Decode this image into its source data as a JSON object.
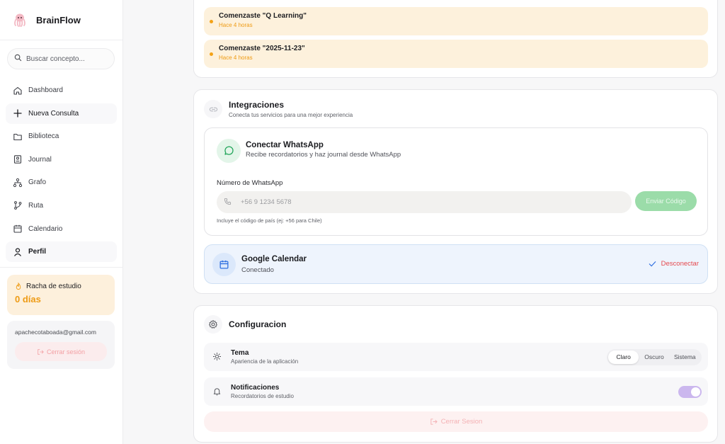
{
  "app": {
    "name": "BrainFlow"
  },
  "search": {
    "placeholder": "Buscar concepto..."
  },
  "nav": [
    {
      "label": "Dashboard",
      "icon": "home-icon"
    },
    {
      "label": "Nueva Consulta",
      "icon": "plus-icon"
    },
    {
      "label": "Biblioteca",
      "icon": "folder-icon"
    },
    {
      "label": "Journal",
      "icon": "journal-icon"
    },
    {
      "label": "Grafo",
      "icon": "graph-icon"
    },
    {
      "label": "Ruta",
      "icon": "branch-icon"
    },
    {
      "label": "Calendario",
      "icon": "calendar-icon"
    },
    {
      "label": "Perfil",
      "icon": "user-icon"
    }
  ],
  "streak": {
    "title": "Racha de estudio",
    "value": "0 días"
  },
  "user": {
    "email": "apachecotaboada@gmail.com",
    "logout": "Cerrar sesión"
  },
  "activity": [
    {
      "text": "Comenzaste \"Q Learning\"",
      "time": "Hace 4 horas"
    },
    {
      "text": "Comenzaste \"2025-11-23\"",
      "time": "Hace 4 horas"
    }
  ],
  "integrations": {
    "title": "Integraciones",
    "subtitle": "Conecta tus servicios para una mejor experiencia",
    "whatsapp": {
      "title": "Conectar WhatsApp",
      "subtitle": "Recibe recordatorios y haz journal desde WhatsApp",
      "label": "Número de WhatsApp",
      "placeholder": "+56 9 1234 5678",
      "button": "Enviar Código",
      "hint": "Incluye el código de país (ej: +56 para Chile)"
    },
    "gcal": {
      "title": "Google Calendar",
      "status": "Conectado",
      "action": "Desconectar"
    }
  },
  "config": {
    "title": "Configuracion",
    "theme": {
      "title": "Tema",
      "subtitle": "Apariencia de la aplicación",
      "options": [
        "Claro",
        "Oscuro",
        "Sistema"
      ],
      "selected": "Claro"
    },
    "notifications": {
      "title": "Notificaciones",
      "subtitle": "Recordatorios de estudio",
      "enabled": true
    },
    "logout": "Cerrar Sesion"
  },
  "colors": {
    "accent_orange": "#ee9b14",
    "whatsapp_green": "#22a55a",
    "calendar_blue": "#2f6fe0",
    "danger": "#e5484d",
    "toggle_purple": "#cbb7ee"
  }
}
